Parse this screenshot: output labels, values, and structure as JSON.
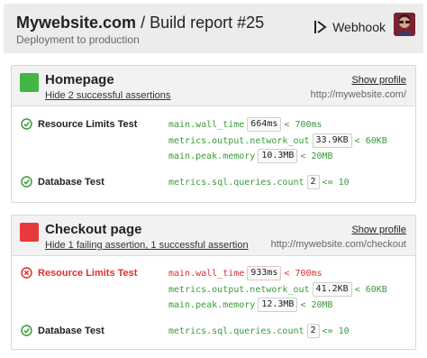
{
  "header": {
    "site": "Mywebsite.com",
    "separator": "/",
    "report": "Build report #25",
    "subtitle": "Deployment to production",
    "webhook_label": "Webhook"
  },
  "colors": {
    "success": "#43b543",
    "fail": "#e83a3a",
    "metric_ok": "#3a9b3a",
    "metric_fail": "#e03030"
  },
  "pages": [
    {
      "title": "Homepage",
      "summary": "Hide 2 successful assertions",
      "show_profile": "Show profile",
      "url": "http://mywebsite.com/",
      "status": "success",
      "tests": [
        {
          "name": "Resource Limits Test",
          "status": "pass",
          "assertions": [
            {
              "metric": "main.wall_time",
              "value": "664ms",
              "op": "< 700ms",
              "status": "pass"
            },
            {
              "metric": "metrics.output.network_out",
              "value": "33.9KB",
              "op": "< 60KB",
              "status": "pass"
            },
            {
              "metric": "main.peak.memory",
              "value": "10.3MB",
              "op": "< 20MB",
              "status": "pass"
            }
          ]
        },
        {
          "name": "Database Test",
          "status": "pass",
          "assertions": [
            {
              "metric": "metrics.sql.queries.count",
              "value": "2",
              "op": "<= 10",
              "status": "pass"
            }
          ]
        }
      ]
    },
    {
      "title": "Checkout page",
      "summary": "Hide 1 failing assertion, 1 successful assertion",
      "show_profile": "Show profile",
      "url": "http://mywebsite.com/checkout",
      "status": "fail",
      "tests": [
        {
          "name": "Resource Limits Test",
          "status": "fail",
          "assertions": [
            {
              "metric": "main.wall_time",
              "value": "933ms",
              "op": "< 700ms",
              "status": "fail"
            },
            {
              "metric": "metrics.output.network_out",
              "value": "41.2KB",
              "op": "< 60KB",
              "status": "pass"
            },
            {
              "metric": "main.peak.memory",
              "value": "12.3MB",
              "op": "< 20MB",
              "status": "pass"
            }
          ]
        },
        {
          "name": "Database Test",
          "status": "pass",
          "assertions": [
            {
              "metric": "metrics.sql.queries.count",
              "value": "2",
              "op": "<= 10",
              "status": "pass"
            }
          ]
        }
      ]
    }
  ]
}
